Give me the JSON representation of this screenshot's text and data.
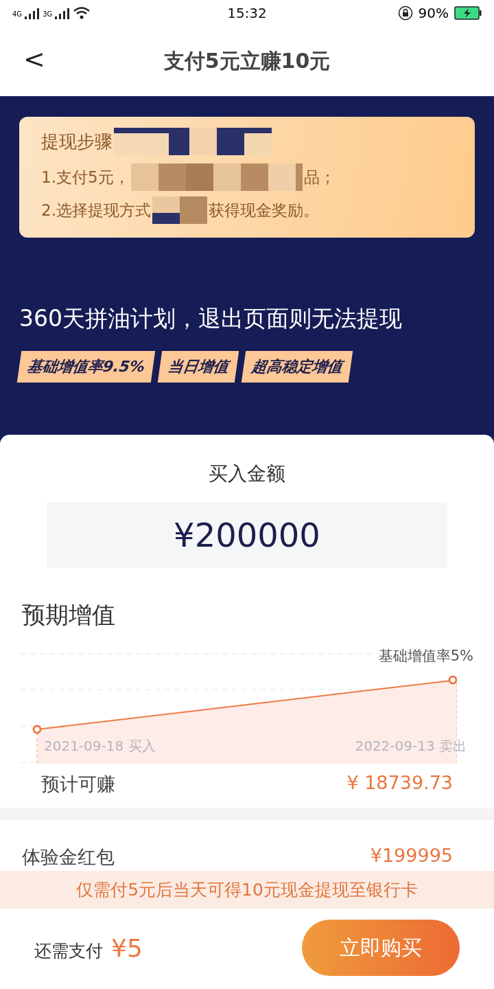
{
  "status_bar": {
    "network_1": "4G",
    "network_2": "3G",
    "time": "15:32",
    "battery": "90%"
  },
  "header": {
    "back": "<",
    "title": "支付5元立赚10元"
  },
  "steps": {
    "title": "提现步骤",
    "line_1_start": "1.支付5元，",
    "line_1_end": "品；",
    "line_2_start": "2.选择提现方式",
    "line_2_end": "获得现金奖励。"
  },
  "plan": {
    "headline": "360天拼油计划，退出页面则无法提现",
    "tags": [
      "基础增值率9.5%",
      "当日增值",
      "超高稳定增值"
    ]
  },
  "purchase": {
    "label": "买入金额",
    "amount": "¥200000"
  },
  "expected": {
    "title": "预期增值",
    "rate_label": "基础增值率5%",
    "start_label": "2021-09-18 买入",
    "end_label": "2022-09-13 卖出",
    "earn_label": "预计可赚",
    "earn_value": "¥ 18739.73"
  },
  "bonus_row": {
    "label": "体验金红包",
    "value": "¥199995"
  },
  "notice": "仅需付5元后当天可得10元现金提现至银行卡",
  "footer": {
    "pay_label": "还需支付",
    "pay_value": "¥5",
    "buy_button": "立即购买"
  }
}
